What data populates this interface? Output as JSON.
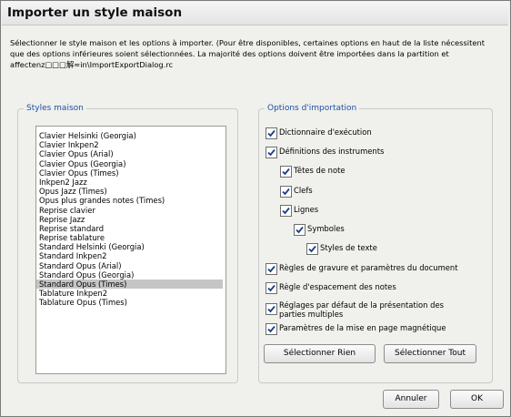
{
  "dialog": {
    "title": "Importer un style maison",
    "description": "Sélectionner le style maison et les options à importer. (Pour être disponibles, certaines options en haut de la liste nécessitent que des options inférieures soient sélectionnées. La majorité des options doivent être importées dans la partition et affectenz□□□解≈in\\ImportExportDialog.rc"
  },
  "styles": {
    "legend": "Styles maison",
    "items": [
      {
        "label": "Clavier Helsinki  (Georgia)"
      },
      {
        "label": "Clavier Inkpen2"
      },
      {
        "label": "Clavier Opus (Arial)"
      },
      {
        "label": "Clavier Opus (Georgia)"
      },
      {
        "label": "Clavier Opus (Times)"
      },
      {
        "label": "Inkpen2 Jazz"
      },
      {
        "label": "Opus Jazz (Times)"
      },
      {
        "label": "Opus plus grandes notes (Times)"
      },
      {
        "label": "Reprise clavier"
      },
      {
        "label": "Reprise Jazz"
      },
      {
        "label": "Reprise standard"
      },
      {
        "label": "Reprise tablature"
      },
      {
        "label": "Standard Helsinki (Georgia)"
      },
      {
        "label": "Standard Inkpen2"
      },
      {
        "label": "Standard Opus (Arial)"
      },
      {
        "label": "Standard Opus (Georgia)"
      },
      {
        "label": "Standard Opus (Times)"
      },
      {
        "label": "Tablature Inkpen2"
      },
      {
        "label": "Tablature Opus (Times)"
      }
    ],
    "selected": "Standard Opus (Times)"
  },
  "options": {
    "legend": "Options d'importation",
    "items": [
      {
        "label": "Dictionnaire d'exécution",
        "checked": true
      },
      {
        "label": "Définitions des instruments",
        "checked": true
      },
      {
        "label": "Têtes de note",
        "checked": true
      },
      {
        "label": "Clefs",
        "checked": true
      },
      {
        "label": "Lignes",
        "checked": true
      },
      {
        "label": "Symboles",
        "checked": true
      },
      {
        "label": "Styles de texte",
        "checked": true
      },
      {
        "label": "Règles de gravure et paramètres du document",
        "checked": true
      },
      {
        "label": "Règle d'espacement des notes",
        "checked": true
      },
      {
        "label": "Réglages par défaut de la présentation des parties multiples",
        "checked": true
      },
      {
        "label": "Paramètres de la mise en page magnétique",
        "checked": true
      }
    ],
    "select_none_label": "Sélectionner Rien",
    "select_all_label": "Sélectionner Tout"
  },
  "footer": {
    "cancel_label": "Annuler",
    "ok_label": "OK"
  }
}
